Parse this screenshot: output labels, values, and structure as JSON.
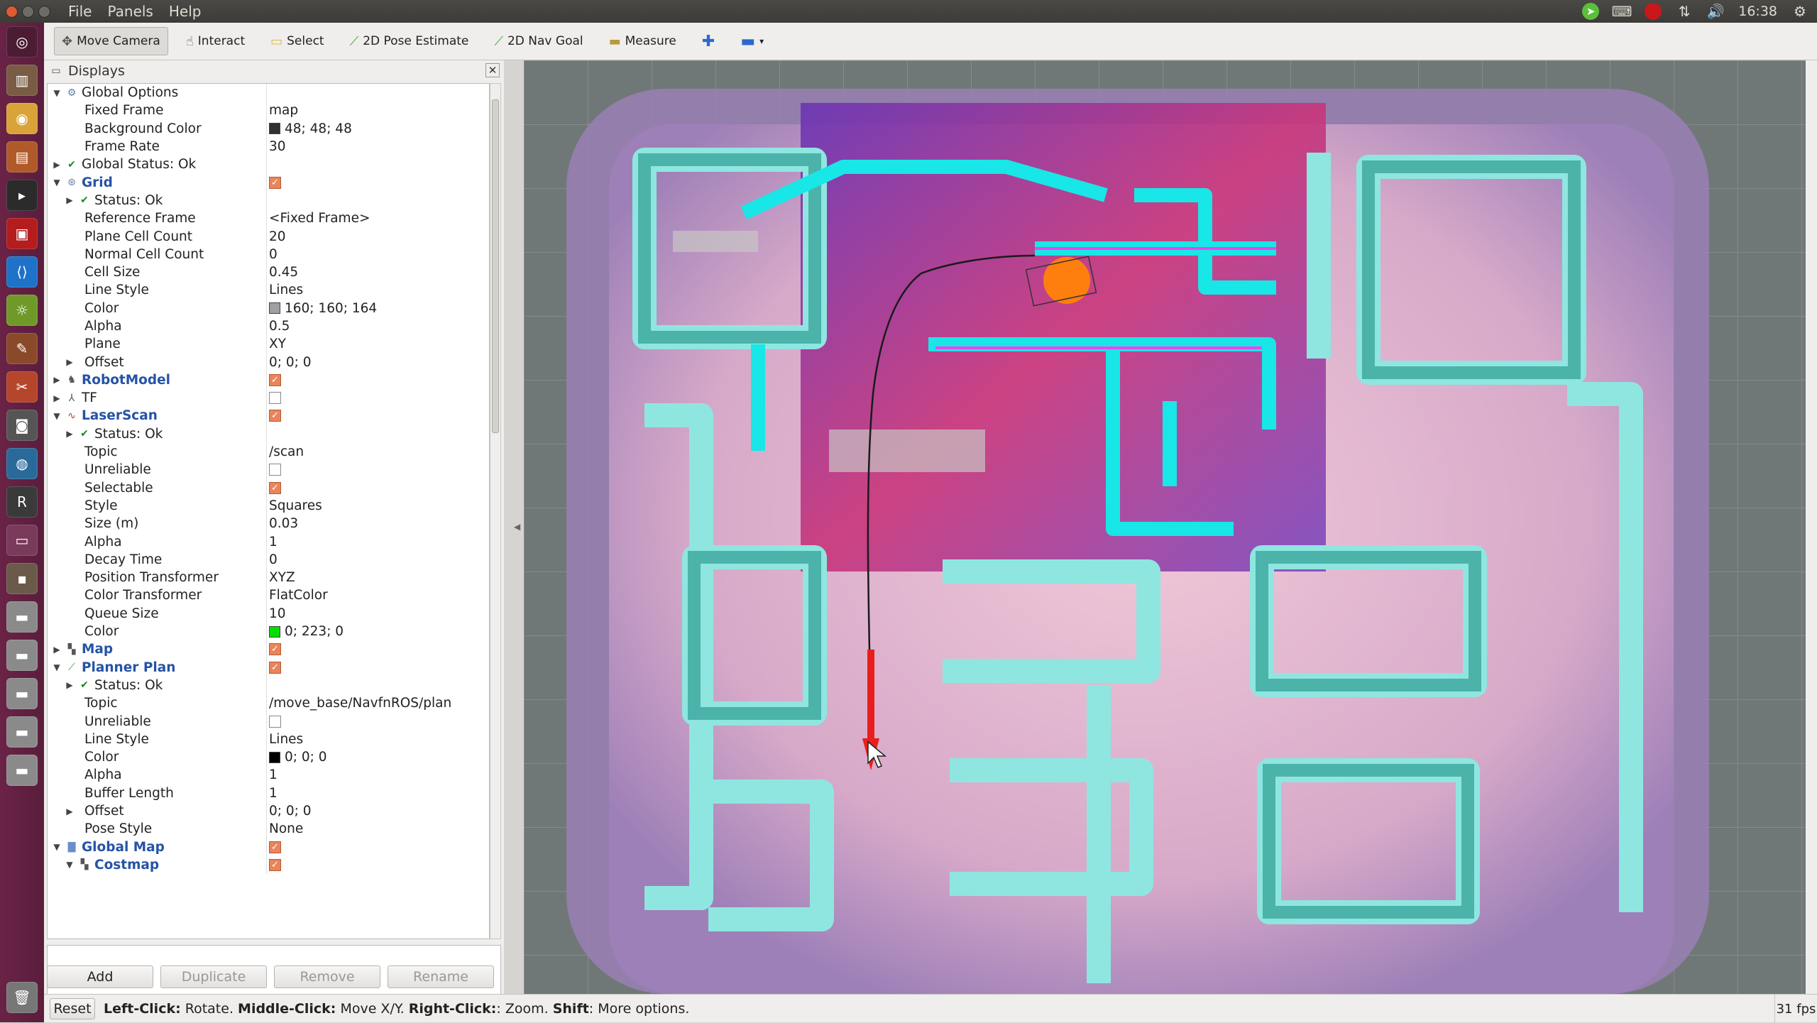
{
  "menubar": {
    "items": [
      "File",
      "Panels",
      "Help"
    ],
    "time": "16:38"
  },
  "toolbar": {
    "tools": [
      {
        "label": "Move Camera",
        "icon": "move-camera-icon",
        "glyph": "✥",
        "active": true
      },
      {
        "label": "Interact",
        "icon": "interact-icon",
        "glyph": "☝"
      },
      {
        "label": "Select",
        "icon": "select-icon",
        "glyph": "▭"
      },
      {
        "label": "2D Pose Estimate",
        "icon": "pose-estimate-icon",
        "glyph": "⟋"
      },
      {
        "label": "2D Nav Goal",
        "icon": "nav-goal-icon",
        "glyph": "⟋"
      },
      {
        "label": "Measure",
        "icon": "measure-icon",
        "glyph": "▬"
      }
    ]
  },
  "displays": {
    "title": "Displays",
    "rows": [
      {
        "indent": 0,
        "arrow": "▼",
        "icon": "gear-icon",
        "label": "Global Options",
        "style": "",
        "value": ""
      },
      {
        "indent": 1,
        "arrow": "",
        "label": "Fixed Frame",
        "value": "map"
      },
      {
        "indent": 1,
        "arrow": "",
        "label": "Background Color",
        "value": "48; 48; 48",
        "swatch": "#303030"
      },
      {
        "indent": 1,
        "arrow": "",
        "label": "Frame Rate",
        "value": "30"
      },
      {
        "indent": 0,
        "arrow": "▶",
        "icon": "check-icon",
        "label": "Global Status: Ok",
        "style": "",
        "value": ""
      },
      {
        "indent": 0,
        "arrow": "▼",
        "icon": "grid-icon",
        "label": "Grid",
        "style": "blue",
        "checkbox": true
      },
      {
        "indent": 1,
        "arrow": "▶",
        "icon": "check-icon",
        "label": "Status: Ok",
        "value": ""
      },
      {
        "indent": 1,
        "arrow": "",
        "label": "Reference Frame",
        "value": "<Fixed Frame>"
      },
      {
        "indent": 1,
        "arrow": "",
        "label": "Plane Cell Count",
        "value": "20"
      },
      {
        "indent": 1,
        "arrow": "",
        "label": "Normal Cell Count",
        "value": "0"
      },
      {
        "indent": 1,
        "arrow": "",
        "label": "Cell Size",
        "value": "0.45"
      },
      {
        "indent": 1,
        "arrow": "",
        "label": "Line Style",
        "value": "Lines"
      },
      {
        "indent": 1,
        "arrow": "",
        "label": "Color",
        "value": "160; 160; 164",
        "swatch": "#a0a0a4"
      },
      {
        "indent": 1,
        "arrow": "",
        "label": "Alpha",
        "value": "0.5"
      },
      {
        "indent": 1,
        "arrow": "",
        "label": "Plane",
        "value": "XY"
      },
      {
        "indent": 1,
        "arrow": "▶",
        "label": "Offset",
        "value": "0; 0; 0"
      },
      {
        "indent": 0,
        "arrow": "▶",
        "icon": "robot-model-icon",
        "label": "RobotModel",
        "style": "blue",
        "checkbox": true
      },
      {
        "indent": 0,
        "arrow": "▶",
        "icon": "tf-icon",
        "label": "TF",
        "style": "",
        "checkbox": false
      },
      {
        "indent": 0,
        "arrow": "▼",
        "icon": "laser-scan-icon",
        "label": "LaserScan",
        "style": "blue",
        "checkbox": true
      },
      {
        "indent": 1,
        "arrow": "▶",
        "icon": "check-icon",
        "label": "Status: Ok",
        "value": ""
      },
      {
        "indent": 1,
        "arrow": "",
        "label": "Topic",
        "value": "/scan"
      },
      {
        "indent": 1,
        "arrow": "",
        "label": "Unreliable",
        "checkbox": false
      },
      {
        "indent": 1,
        "arrow": "",
        "label": "Selectable",
        "checkbox": true
      },
      {
        "indent": 1,
        "arrow": "",
        "label": "Style",
        "value": "Squares"
      },
      {
        "indent": 1,
        "arrow": "",
        "label": "Size (m)",
        "value": "0.03"
      },
      {
        "indent": 1,
        "arrow": "",
        "label": "Alpha",
        "value": "1"
      },
      {
        "indent": 1,
        "arrow": "",
        "label": "Decay Time",
        "value": "0"
      },
      {
        "indent": 1,
        "arrow": "",
        "label": "Position Transformer",
        "value": "XYZ"
      },
      {
        "indent": 1,
        "arrow": "",
        "label": "Color Transformer",
        "value": "FlatColor"
      },
      {
        "indent": 1,
        "arrow": "",
        "label": "Queue Size",
        "value": "10"
      },
      {
        "indent": 1,
        "arrow": "",
        "label": "Color",
        "value": "0; 223; 0",
        "swatch": "#00df00"
      },
      {
        "indent": 0,
        "arrow": "▶",
        "icon": "map-icon",
        "label": "Map",
        "style": "blue",
        "checkbox": true
      },
      {
        "indent": 0,
        "arrow": "▼",
        "icon": "path-icon",
        "label": "Planner Plan",
        "style": "blue",
        "checkbox": true
      },
      {
        "indent": 1,
        "arrow": "▶",
        "icon": "check-icon",
        "label": "Status: Ok",
        "value": ""
      },
      {
        "indent": 1,
        "arrow": "",
        "label": "Topic",
        "value": "/move_base/NavfnROS/plan"
      },
      {
        "indent": 1,
        "arrow": "",
        "label": "Unreliable",
        "checkbox": false
      },
      {
        "indent": 1,
        "arrow": "",
        "label": "Line Style",
        "value": "Lines"
      },
      {
        "indent": 1,
        "arrow": "",
        "label": "Color",
        "value": "0; 0; 0",
        "swatch": "#000000"
      },
      {
        "indent": 1,
        "arrow": "",
        "label": "Alpha",
        "value": "1"
      },
      {
        "indent": 1,
        "arrow": "",
        "label": "Buffer Length",
        "value": "1"
      },
      {
        "indent": 1,
        "arrow": "▶",
        "label": "Offset",
        "value": "0; 0; 0"
      },
      {
        "indent": 1,
        "arrow": "",
        "label": "Pose Style",
        "value": "None"
      },
      {
        "indent": 0,
        "arrow": "▼",
        "icon": "folder-icon",
        "label": "Global Map",
        "style": "blue",
        "checkbox": true
      },
      {
        "indent": 1,
        "arrow": "▼",
        "icon": "map-icon",
        "label": "Costmap",
        "style": "blue",
        "checkbox": true
      }
    ],
    "buttons": {
      "add": "Add",
      "duplicate": "Duplicate",
      "remove": "Remove",
      "rename": "Rename"
    }
  },
  "statusbar": {
    "reset": "Reset",
    "hint_parts": [
      {
        "b": "Left-Click:",
        "t": " Rotate. "
      },
      {
        "b": "Middle-Click:",
        "t": " Move X/Y. "
      },
      {
        "b": "Right-Click:",
        "t": ": Zoom. "
      },
      {
        "b": "Shift",
        "t": ": More options."
      }
    ],
    "fps": "31 fps"
  }
}
